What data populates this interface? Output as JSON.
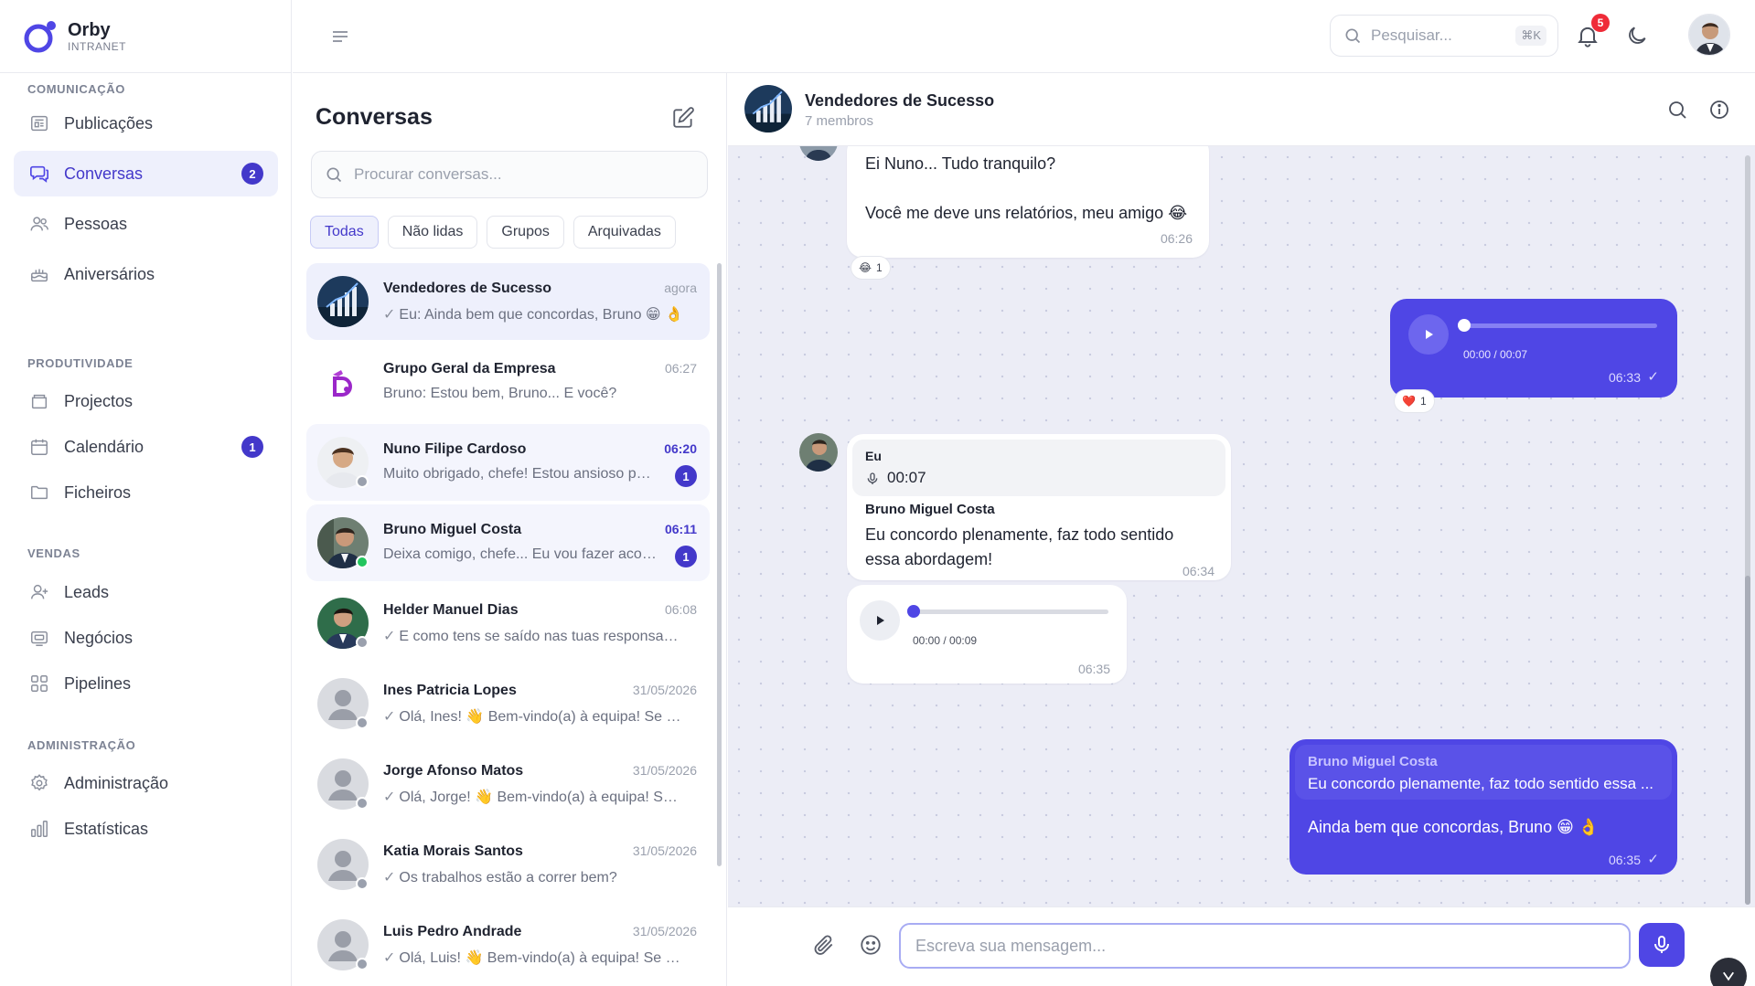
{
  "brand": {
    "name": "Orby",
    "sub": "INTRANET",
    "color": "#4f46e5"
  },
  "sidebar": {
    "sections": [
      {
        "title": "COMUNICAÇÃO",
        "items": [
          {
            "label": "Publicações",
            "icon": "newspaper-icon"
          },
          {
            "label": "Conversas",
            "icon": "chat-bubbles-icon",
            "badge": "2",
            "active": true
          },
          {
            "label": "Pessoas",
            "icon": "users-icon"
          },
          {
            "label": "Aniversários",
            "icon": "cake-icon"
          }
        ]
      },
      {
        "title": "PRODUTIVIDADE",
        "items": [
          {
            "label": "Projectos",
            "icon": "box-icon"
          },
          {
            "label": "Calendário",
            "icon": "calendar-icon",
            "badge": "1"
          },
          {
            "label": "Ficheiros",
            "icon": "folder-icon"
          }
        ]
      },
      {
        "title": "VENDAS",
        "items": [
          {
            "label": "Leads",
            "icon": "user-plus-icon"
          },
          {
            "label": "Negócios",
            "icon": "briefcase-icon"
          },
          {
            "label": "Pipelines",
            "icon": "grid-icon"
          }
        ]
      },
      {
        "title": "ADMINISTRAÇÃO",
        "items": [
          {
            "label": "Administração",
            "icon": "gear-icon"
          },
          {
            "label": "Estatísticas",
            "icon": "bar-chart-icon"
          }
        ]
      }
    ]
  },
  "topbar": {
    "search_placeholder": "Pesquisar...",
    "shortcut": "⌘K",
    "notifications_count": "5"
  },
  "conversations": {
    "title": "Conversas",
    "search_placeholder": "Procurar conversas...",
    "filters": [
      "Todas",
      "Não lidas",
      "Grupos",
      "Arquivadas"
    ],
    "items": [
      {
        "name": "Vendedores de Sucesso",
        "time": "agora",
        "preview": "Eu: Ainda bem que concordas, Bruno 😁 👌",
        "tick": "✓"
      },
      {
        "name": "Grupo Geral da Empresa",
        "time": "06:27",
        "preview": "Bruno: Estou bem, Bruno... E você?",
        "tick": ""
      },
      {
        "name": "Nuno Filipe Cardoso",
        "time": "06:20",
        "preview": "Muito obrigado, chefe! Estou ansioso para começar",
        "unread": "1",
        "tick": ""
      },
      {
        "name": "Bruno Miguel Costa",
        "time": "06:11",
        "preview": "Deixa comigo, chefe... Eu vou fazer acontecer",
        "unread": "1",
        "tick": ""
      },
      {
        "name": "Helder Manuel Dias",
        "time": "06:08",
        "preview": "E como tens se saído nas tuas responsabilidades?",
        "tick": "✓"
      },
      {
        "name": "Ines Patricia Lopes",
        "time": "31/05/2026",
        "preview": "Olá, Ines! 👋 Bem-vindo(a) à equipa! Se precisares",
        "tick": "✓"
      },
      {
        "name": "Jorge Afonso Matos",
        "time": "31/05/2026",
        "preview": "Olá, Jorge! 👋 Bem-vindo(a) à equipa! Se precisares",
        "tick": "✓"
      },
      {
        "name": "Katia Morais Santos",
        "time": "31/05/2026",
        "preview": "Os trabalhos estão a correr bem?",
        "tick": "✓"
      },
      {
        "name": "Luis Pedro Andrade",
        "time": "31/05/2026",
        "preview": "Olá, Luis! 👋 Bem-vindo(a) à equipa! Se precisares",
        "tick": "✓"
      }
    ]
  },
  "chat": {
    "name": "Vendedores de Sucesso",
    "members": "7 membros",
    "messages": {
      "m1_line1": "Ei Nuno... Tudo tranquilo?",
      "m1_line2": "Você me deve uns relatórios, meu amigo 😂",
      "m1_time": "06:26",
      "m1_reaction": "😂",
      "m1_reaction_count": "1",
      "m2_audio_time": "00:00 / 00:07",
      "m2_time": "06:33",
      "m2_tick": "✓",
      "m2_reaction": "❤️",
      "m2_reaction_count": "1",
      "m3_quote_author": "Eu",
      "m3_quote_audio": "00:07",
      "m3_author": "Bruno Miguel Costa",
      "m3_text": "Eu concordo plenamente, faz todo sentido essa abordagem!",
      "m3_time": "06:34",
      "m4_audio_time": "00:00 / 00:09",
      "m4_time": "06:35",
      "m5_quote_author": "Bruno Miguel Costa",
      "m5_quote_text": "Eu concordo plenamente, faz todo sentido essa ...",
      "m5_text": "Ainda bem que concordas, Bruno 😁 👌",
      "m5_time": "06:35",
      "m5_tick": "✓"
    }
  },
  "composer": {
    "placeholder": "Escreva sua mensagem..."
  }
}
